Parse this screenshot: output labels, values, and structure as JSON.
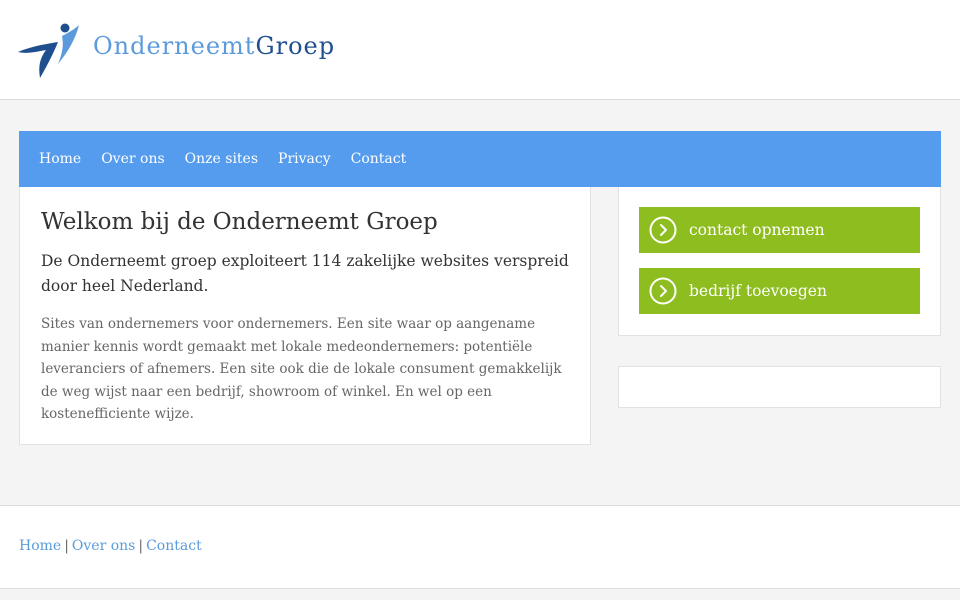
{
  "header": {
    "logo_light": "Onderneemt",
    "logo_dark": "Groep",
    "logo_icon": "figure-logo-icon"
  },
  "nav": {
    "items": [
      {
        "label": "Home"
      },
      {
        "label": "Over ons"
      },
      {
        "label": "Onze sites"
      },
      {
        "label": "Privacy"
      },
      {
        "label": "Contact"
      }
    ]
  },
  "main": {
    "title": "Welkom bij de Onderneemt Groep",
    "lead": "De Onderneemt groep exploiteert 114 zakelijke websites verspreid door heel Nederland.",
    "body": "Sites van ondernemers voor ondernemers. Een site waar op aangename manier kennis wordt gemaakt met lokale medeondernemers: potentiële leveranciers of afnemers. Een site ook die de lokale consument gemakkelijk de weg wijst naar een bedrijf, showroom of winkel. En wel op een kostenefficiente wijze."
  },
  "sidebar": {
    "buttons": [
      {
        "label": "contact opnemen",
        "icon": "play-circle-icon"
      },
      {
        "label": "bedrijf toevoegen",
        "icon": "play-circle-icon"
      }
    ]
  },
  "footer": {
    "links": [
      {
        "label": "Home"
      },
      {
        "label": "Over ons"
      },
      {
        "label": "Contact"
      }
    ],
    "separator": "|"
  },
  "colors": {
    "nav_bg": "#559cee",
    "cta_bg": "#8dbd1e",
    "logo_light": "#5b9bdc",
    "logo_dark": "#1f4f8f",
    "link": "#5b9bdc"
  }
}
